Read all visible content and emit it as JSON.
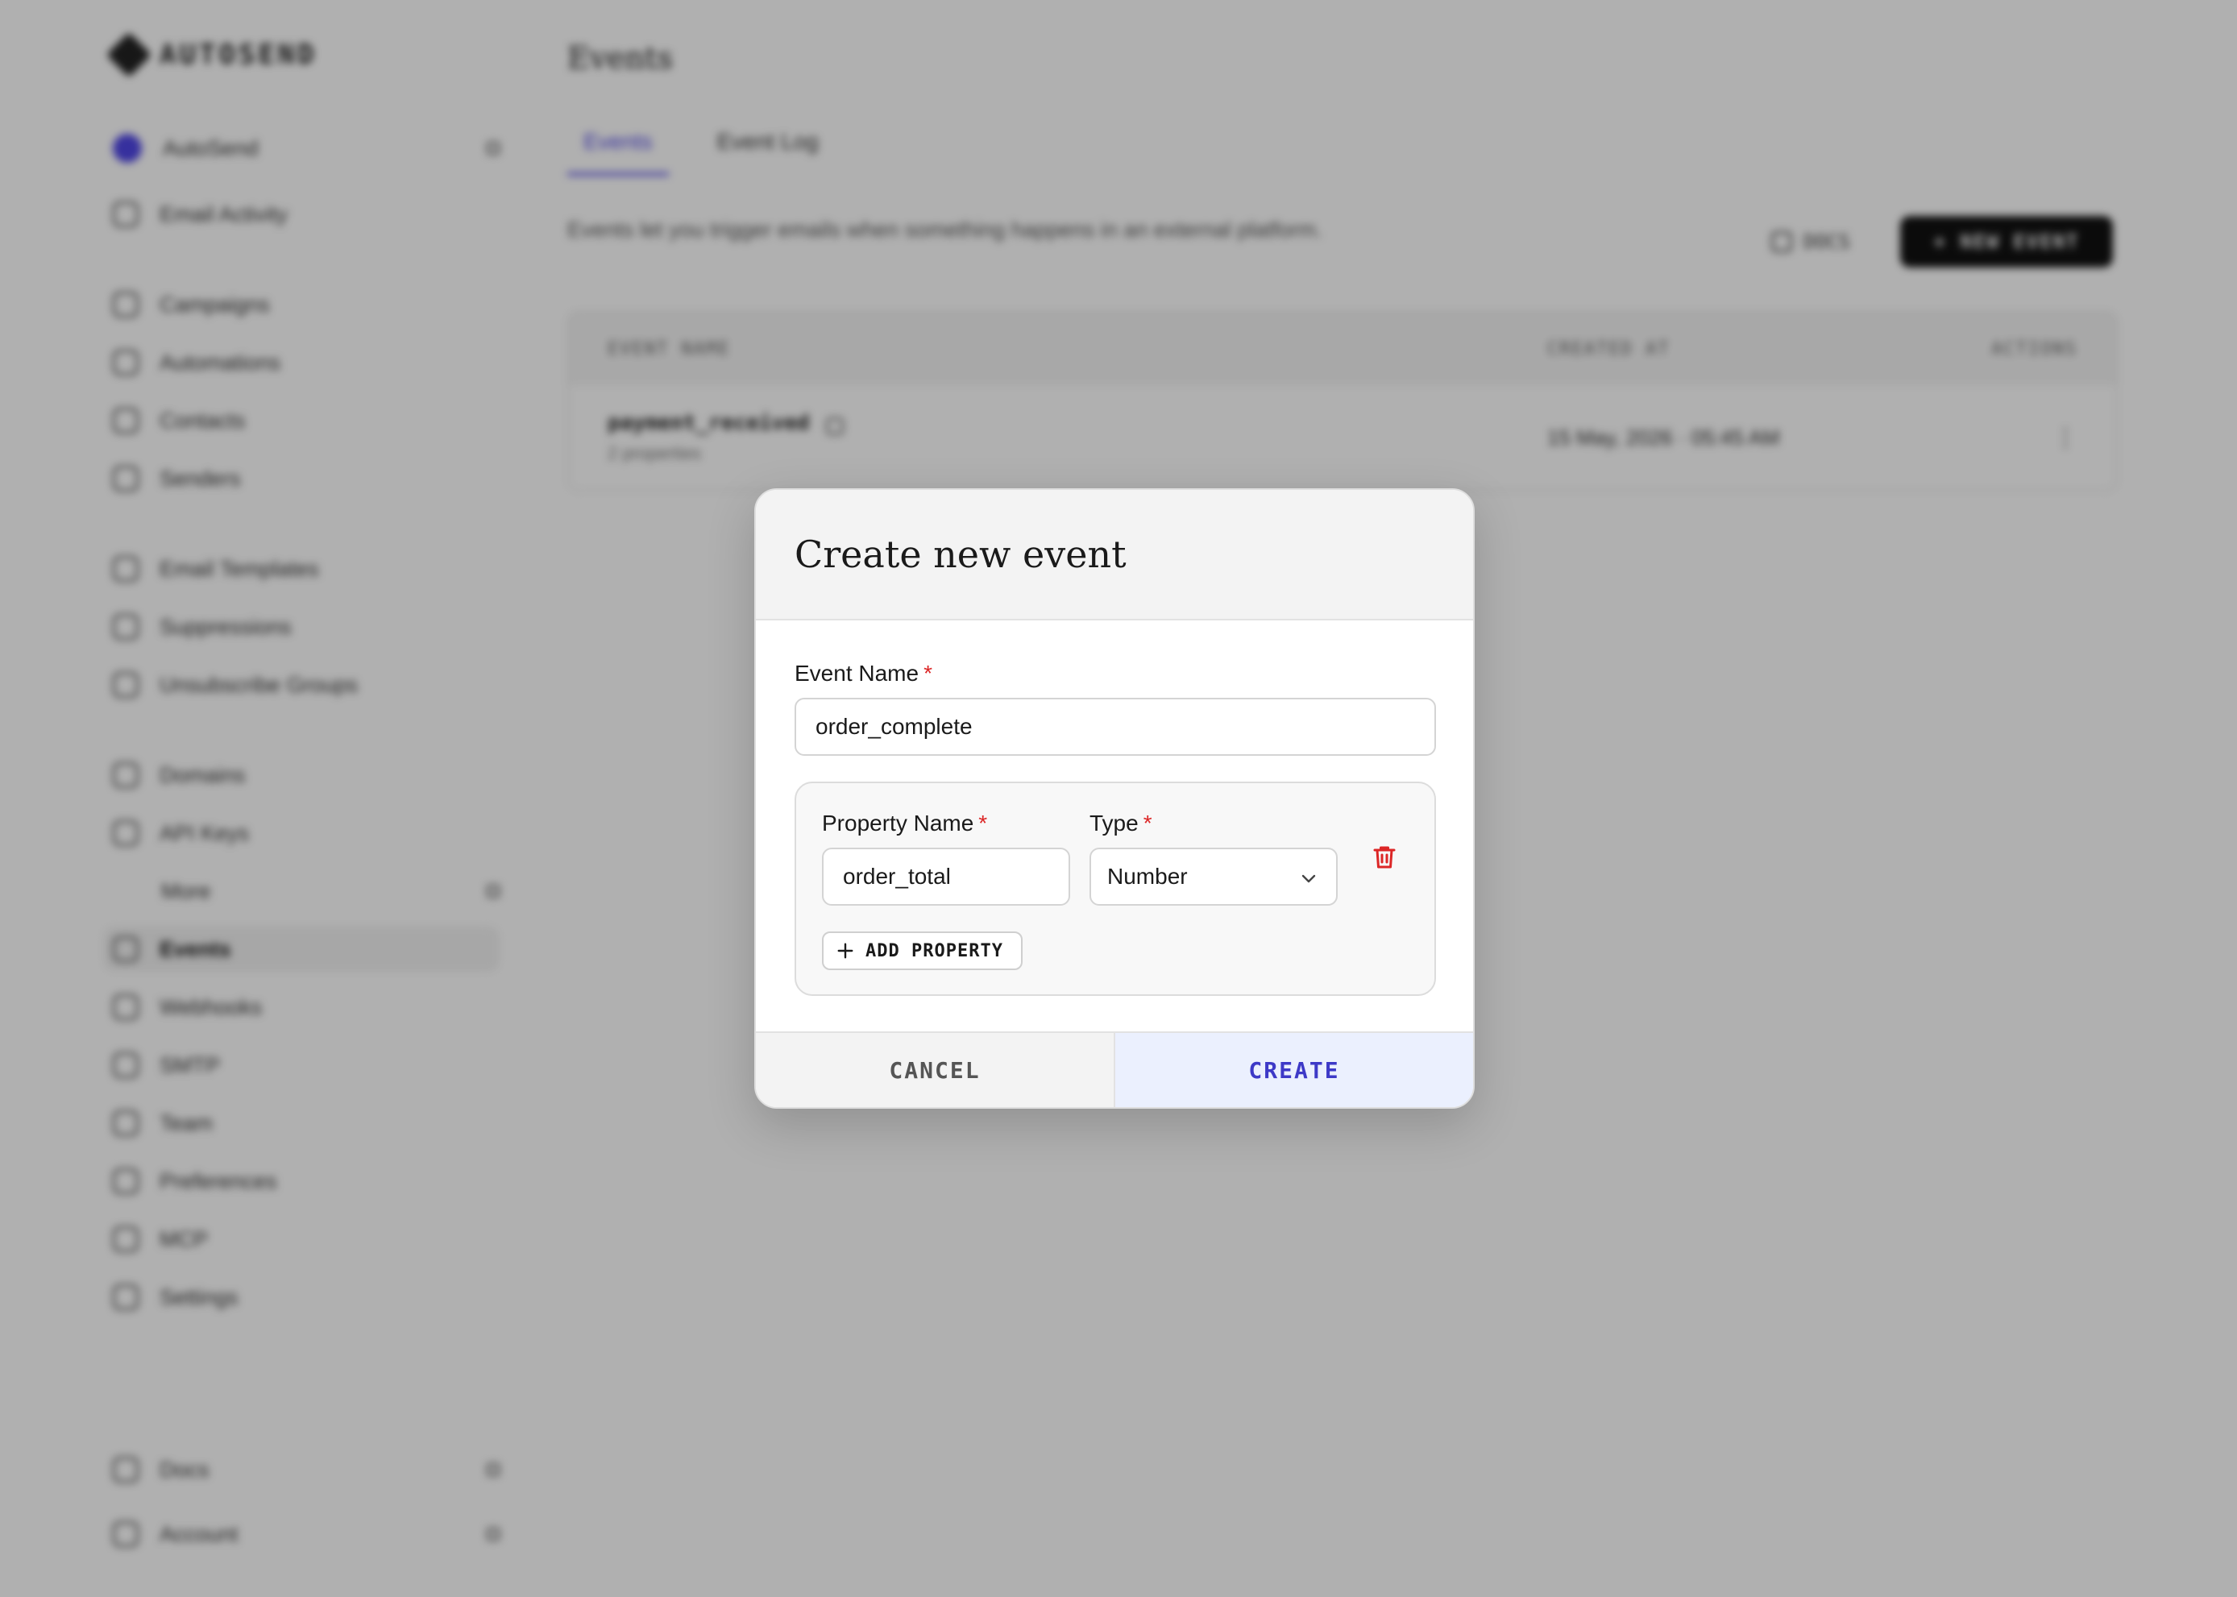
{
  "app": {
    "logo_text": "AUTOSEND",
    "org_name": "AutoSend",
    "accent": "#4f46e5"
  },
  "sidebar": {
    "items": [
      {
        "label": "Email Activity"
      },
      {
        "label": "Campaigns"
      },
      {
        "label": "Automations"
      },
      {
        "label": "Contacts"
      },
      {
        "label": "Senders"
      },
      {
        "label": "Email Templates"
      },
      {
        "label": "Suppressions"
      },
      {
        "label": "Unsubscribe Groups"
      },
      {
        "label": "Domains"
      },
      {
        "label": "API Keys"
      },
      {
        "label": "More"
      },
      {
        "label": "Events"
      },
      {
        "label": "Webhooks"
      },
      {
        "label": "SMTP"
      },
      {
        "label": "Team"
      },
      {
        "label": "Preferences"
      },
      {
        "label": "MCP"
      },
      {
        "label": "Settings"
      }
    ],
    "bottom": [
      {
        "label": "Docs"
      },
      {
        "label": "Account"
      }
    ]
  },
  "main": {
    "title": "Events",
    "tabs": [
      {
        "label": "Events"
      },
      {
        "label": "Event Log"
      }
    ],
    "description": "Events let you trigger emails when something happens in an external platform.",
    "docs_label": "DOCS",
    "new_event_label": "+ NEW EVENT",
    "table": {
      "headers": [
        "EVENT NAME",
        "CREATED AT",
        "ACTIONS"
      ],
      "rows": [
        {
          "name": "payment_received",
          "sub": "2 properties",
          "created": "15 May, 2026 · 05:45 AM",
          "action": "⋮"
        }
      ]
    }
  },
  "modal": {
    "title": "Create new event",
    "event_name_label": "Event Name",
    "required_mark": "*",
    "event_name_value": "order_complete",
    "property_name_label": "Property Name",
    "type_label": "Type",
    "property_name_value": "order_total",
    "type_value": "Number",
    "add_property_label": "ADD PROPERTY",
    "cancel_label": "CANCEL",
    "create_label": "CREATE",
    "danger_color": "#dc2626",
    "create_color": "#3d39c7"
  }
}
